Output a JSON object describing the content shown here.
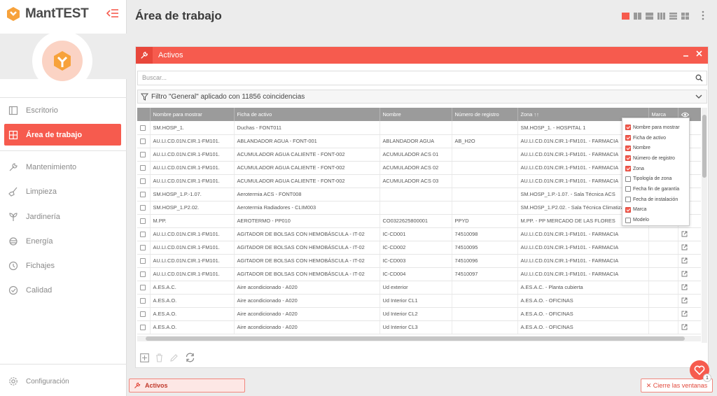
{
  "app": {
    "name": "MantTEST"
  },
  "page": {
    "title": "Área de trabajo"
  },
  "sidebar": {
    "items": [
      {
        "label": "Escritorio",
        "icon": "desktop-icon"
      },
      {
        "label": "Área de trabajo",
        "icon": "workspace-icon"
      },
      {
        "label": "Mantenimiento",
        "icon": "wrench-icon"
      },
      {
        "label": "Limpieza",
        "icon": "broom-icon"
      },
      {
        "label": "Jardinería",
        "icon": "plant-icon"
      },
      {
        "label": "Energía",
        "icon": "energy-icon"
      },
      {
        "label": "Fichajes",
        "icon": "clock-icon"
      },
      {
        "label": "Calidad",
        "icon": "check-icon"
      }
    ],
    "config_label": "Configuración"
  },
  "panel": {
    "title": "Activos",
    "search_placeholder": "Buscar...",
    "filter_text": "Filtro \"General\" aplicado con 11856 coincidencias",
    "columns": [
      "Nombre para mostrar",
      "Ficha de activo",
      "Nombre",
      "Número de registro",
      "Zona ↑↑",
      "Marca"
    ],
    "rows": [
      [
        "SM.HOSP_1.",
        "Duchas - FONT011",
        "",
        "",
        "SM.HOSP_1. - HOSPITAL 1",
        ""
      ],
      [
        "AU.LI.CD.01N.CIR.1-FM101.",
        "ABLANDADOR AGUA - FONT-001",
        "ABLANDADOR AGUA",
        "AB_H2O",
        "AU.LI.CD.01N.CIR.1-FM101. - FARMACIA",
        ""
      ],
      [
        "AU.LI.CD.01N.CIR.1-FM101.",
        "ACUMULADOR AGUA CALIENTE - FONT-002",
        "ACUMULADOR ACS 01",
        "",
        "AU.LI.CD.01N.CIR.1-FM101. - FARMACIA",
        ""
      ],
      [
        "AU.LI.CD.01N.CIR.1-FM101.",
        "ACUMULADOR AGUA CALIENTE - FONT-002",
        "ACUMULADOR ACS 02",
        "",
        "AU.LI.CD.01N.CIR.1-FM101. - FARMACIA",
        ""
      ],
      [
        "AU.LI.CD.01N.CIR.1-FM101.",
        "ACUMULADOR AGUA CALIENTE - FONT-002",
        "ACUMULADOR ACS 03",
        "",
        "AU.LI.CD.01N.CIR.1-FM101. - FARMACIA",
        ""
      ],
      [
        "SM.HOSP_1.P.-1.07.",
        "Aerotermia ACS - FONT008",
        "",
        "",
        "SM.HOSP_1.P.-1.07. - Sala Técnica ACS",
        ""
      ],
      [
        "SM.HOSP_1.P2.02.",
        "Aerotermia Radiadores - CLIM003",
        "",
        "",
        "SM.HOSP_1.P2.02. - Sala Técnica Climatización",
        ""
      ],
      [
        "M.PP.",
        "AEROTERMO - PP010",
        "CO0322625800001",
        "PPYD",
        "M.PP. - PP MERCADO DE LAS FLORES",
        ""
      ],
      [
        "AU.LI.CD.01N.CIR.1-FM101.",
        "AGITADOR DE BOLSAS CON HEMOBÁSCULA - IT-02",
        "IC-CD001",
        "74510098",
        "AU.LI.CD.01N.CIR.1-FM101. - FARMACIA",
        ""
      ],
      [
        "AU.LI.CD.01N.CIR.1-FM101.",
        "AGITADOR DE BOLSAS CON HEMOBÁSCULA - IT-02",
        "IC-CD002",
        "74510095",
        "AU.LI.CD.01N.CIR.1-FM101. - FARMACIA",
        ""
      ],
      [
        "AU.LI.CD.01N.CIR.1-FM101.",
        "AGITADOR DE BOLSAS CON HEMOBÁSCULA - IT-02",
        "IC-CD003",
        "74510096",
        "AU.LI.CD.01N.CIR.1-FM101. - FARMACIA",
        ""
      ],
      [
        "AU.LI.CD.01N.CIR.1-FM101.",
        "AGITADOR DE BOLSAS CON HEMOBÁSCULA - IT-02",
        "IC-CD004",
        "74510097",
        "AU.LI.CD.01N.CIR.1-FM101. - FARMACIA",
        ""
      ],
      [
        "A.ES.A.C.",
        "Aire acondicionado - A020",
        "Ud exterior",
        "",
        "A.ES.A.C. - Planta cubierta",
        ""
      ],
      [
        "A.ES.A.O.",
        "Aire acondicionado - A020",
        "Ud Interior CL1",
        "",
        "A.ES.A.O. - OFICINAS",
        ""
      ],
      [
        "A.ES.A.O.",
        "Aire acondicionado - A020",
        "Ud Interior CL2",
        "",
        "A.ES.A.O. - OFICINAS",
        ""
      ],
      [
        "A.ES.A.O.",
        "Aire acondicionado - A020",
        "Ud Interior CL3",
        "",
        "A.ES.A.O. - OFICINAS",
        ""
      ]
    ],
    "column_menu": [
      {
        "label": "Nombre para mostrar",
        "checked": true
      },
      {
        "label": "Ficha de activo",
        "checked": true
      },
      {
        "label": "Nombre",
        "checked": true
      },
      {
        "label": "Número de registro",
        "checked": true
      },
      {
        "label": "Zona",
        "checked": true
      },
      {
        "label": "Tipología de zona",
        "checked": false
      },
      {
        "label": "Fecha fin de garantía",
        "checked": false
      },
      {
        "label": "Fecha de instalación",
        "checked": false
      },
      {
        "label": "Marca",
        "checked": true
      },
      {
        "label": "Modelo",
        "checked": false
      }
    ]
  },
  "bottom": {
    "tab_label": "Activos",
    "close_all_label": "✕ Cierre las ventanas",
    "badge_count": "1"
  },
  "colors": {
    "accent": "#f65b4e",
    "accent_dark": "#e8473b",
    "header_gray": "#9b9b9b"
  }
}
